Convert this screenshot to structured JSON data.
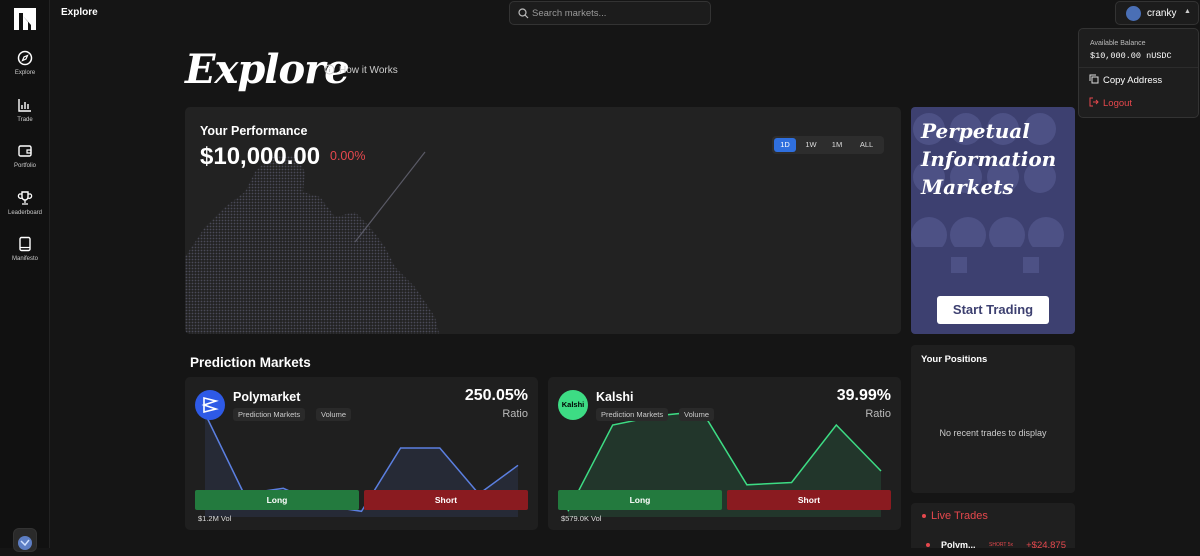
{
  "topbar": {
    "title": "Explore"
  },
  "search": {
    "placeholder": "Search markets..."
  },
  "user": {
    "name": "cranky"
  },
  "dropdown": {
    "balance_label": "Available Balance",
    "balance_value": "$10,000.00 nUSDC",
    "copy_label": "Copy Address",
    "logout_label": "Logout"
  },
  "sidebar": {
    "items": [
      {
        "label": "Explore",
        "icon": "compass-icon"
      },
      {
        "label": "Trade",
        "icon": "bar-chart-icon"
      },
      {
        "label": "Portfolio",
        "icon": "wallet-icon"
      },
      {
        "label": "Leaderboard",
        "icon": "trophy-icon"
      },
      {
        "label": "Manifesto",
        "icon": "book-icon"
      }
    ]
  },
  "header": {
    "title": "Explore",
    "how_it_works": "How it Works"
  },
  "performance": {
    "label": "Your Performance",
    "value": "$10,000.00",
    "change": "0.00%",
    "ranges": [
      "1D",
      "1W",
      "1M",
      "ALL"
    ],
    "active_range": "1D"
  },
  "promo": {
    "lines": [
      "Perpetual",
      "Information",
      "Markets"
    ],
    "button": "Start Trading"
  },
  "prediction_markets": {
    "title": "Prediction Markets",
    "cards": [
      {
        "name": "Polymarket",
        "tags": [
          "Prediction Markets",
          "Volume"
        ],
        "pct": "250.05%",
        "sub": "Ratio",
        "long": "Long",
        "short": "Short",
        "vol": "$1.2M Vol",
        "line_color": "#5b7fe0",
        "series": [
          90,
          20,
          25,
          10,
          5,
          60,
          60,
          20,
          45
        ]
      },
      {
        "name": "Kalshi",
        "logo_text": "Kalshi",
        "tags": [
          "Prediction Markets",
          "Volume"
        ],
        "pct": "39.99%",
        "sub": "Ratio",
        "long": "Long",
        "short": "Short",
        "vol": "$579.0K Vol",
        "line_color": "#3ddc84",
        "series": [
          5,
          80,
          88,
          92,
          28,
          30,
          80,
          40
        ]
      }
    ]
  },
  "positions": {
    "title": "Your Positions",
    "empty": "No recent trades to display"
  },
  "live_trades": {
    "title": "Live Trades",
    "rows": [
      {
        "name": "Polym...",
        "tag": "SHORT 5x",
        "amount": "+$24,875"
      }
    ]
  },
  "colors": {
    "accent": "#2f6fde",
    "long": "#237a3e",
    "short": "#8a1b20",
    "negative": "#e5484d",
    "promo_bg": "#3d4070"
  }
}
